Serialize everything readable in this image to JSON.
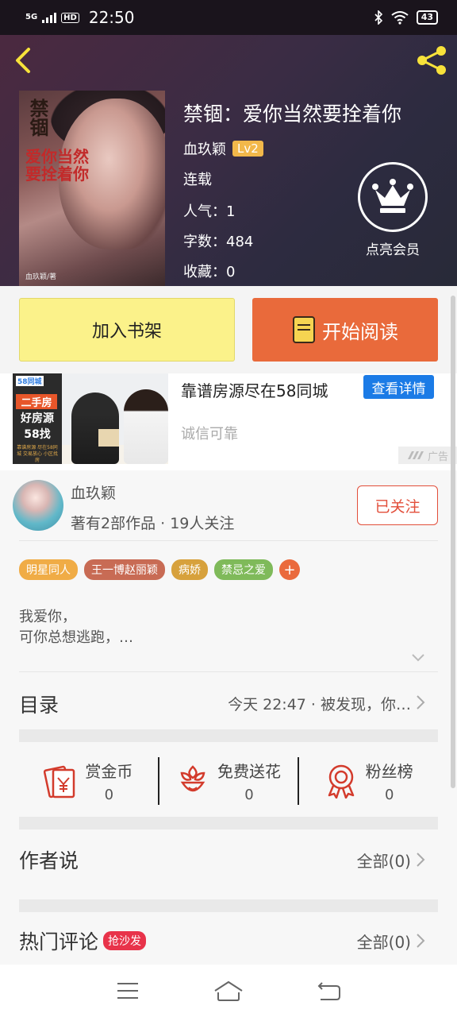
{
  "status_bar": {
    "network": "5G",
    "hd": "HD",
    "time": "22:50",
    "battery": "43"
  },
  "book": {
    "title": "禁锢：爱你当然要拴着你",
    "author": "血玖颖",
    "level": "Lv2",
    "status": "连载",
    "popularity": "人气：1",
    "word_count": "字数：484",
    "favorites": "收藏：0",
    "vip_label": "点亮会员",
    "cover": {
      "title": "禁锢",
      "subtitle": "爱你当然要拴着你",
      "author": "血玖颖/著"
    }
  },
  "actions": {
    "add_shelf": "加入书架",
    "start_read": "开始阅读"
  },
  "ad": {
    "image_logo": "58同城",
    "image_line1": "二手房",
    "image_line2": "好房源",
    "image_line3": "58找",
    "image_small": "靠谱房源 尽在58同城 交易放心 小区找房",
    "title": "靠谱房源尽在58同城",
    "button": "查看详情",
    "desc": "诚信可靠",
    "tag": "广告"
  },
  "author_block": {
    "name": "血玖颖",
    "meta": "著有2部作品 · 19人关注",
    "follow": "已关注"
  },
  "tags": [
    {
      "label": "明星同人",
      "color": "#f0ac46"
    },
    {
      "label": "王一博赵丽颖",
      "color": "#c86b54"
    },
    {
      "label": "病娇",
      "color": "#d7a13c"
    },
    {
      "label": "禁忌之爱",
      "color": "#7fba5a"
    }
  ],
  "tag_plus": "+",
  "intro": {
    "line1": "我爱你，",
    "line2": "可你总想逃跑，…"
  },
  "toc": {
    "label": "目录",
    "latest": "今天 22:47 · 被发现，你…"
  },
  "stats": [
    {
      "label": "赏金币",
      "value": "0",
      "icon": "red-envelope-icon"
    },
    {
      "label": "免费送花",
      "value": "0",
      "icon": "flower-icon"
    },
    {
      "label": "粉丝榜",
      "value": "0",
      "icon": "ribbon-award-icon"
    }
  ],
  "author_says": {
    "title": "作者说",
    "all": "全部(0)"
  },
  "hot_comments": {
    "title": "热门评论",
    "badge": "抢沙发",
    "all": "全部(0)"
  },
  "colors": {
    "accent_orange": "#e96a3b",
    "shelf_yellow": "#fbf28a",
    "follow_red": "#e24e3a",
    "ad_blue": "#1b7be6"
  }
}
